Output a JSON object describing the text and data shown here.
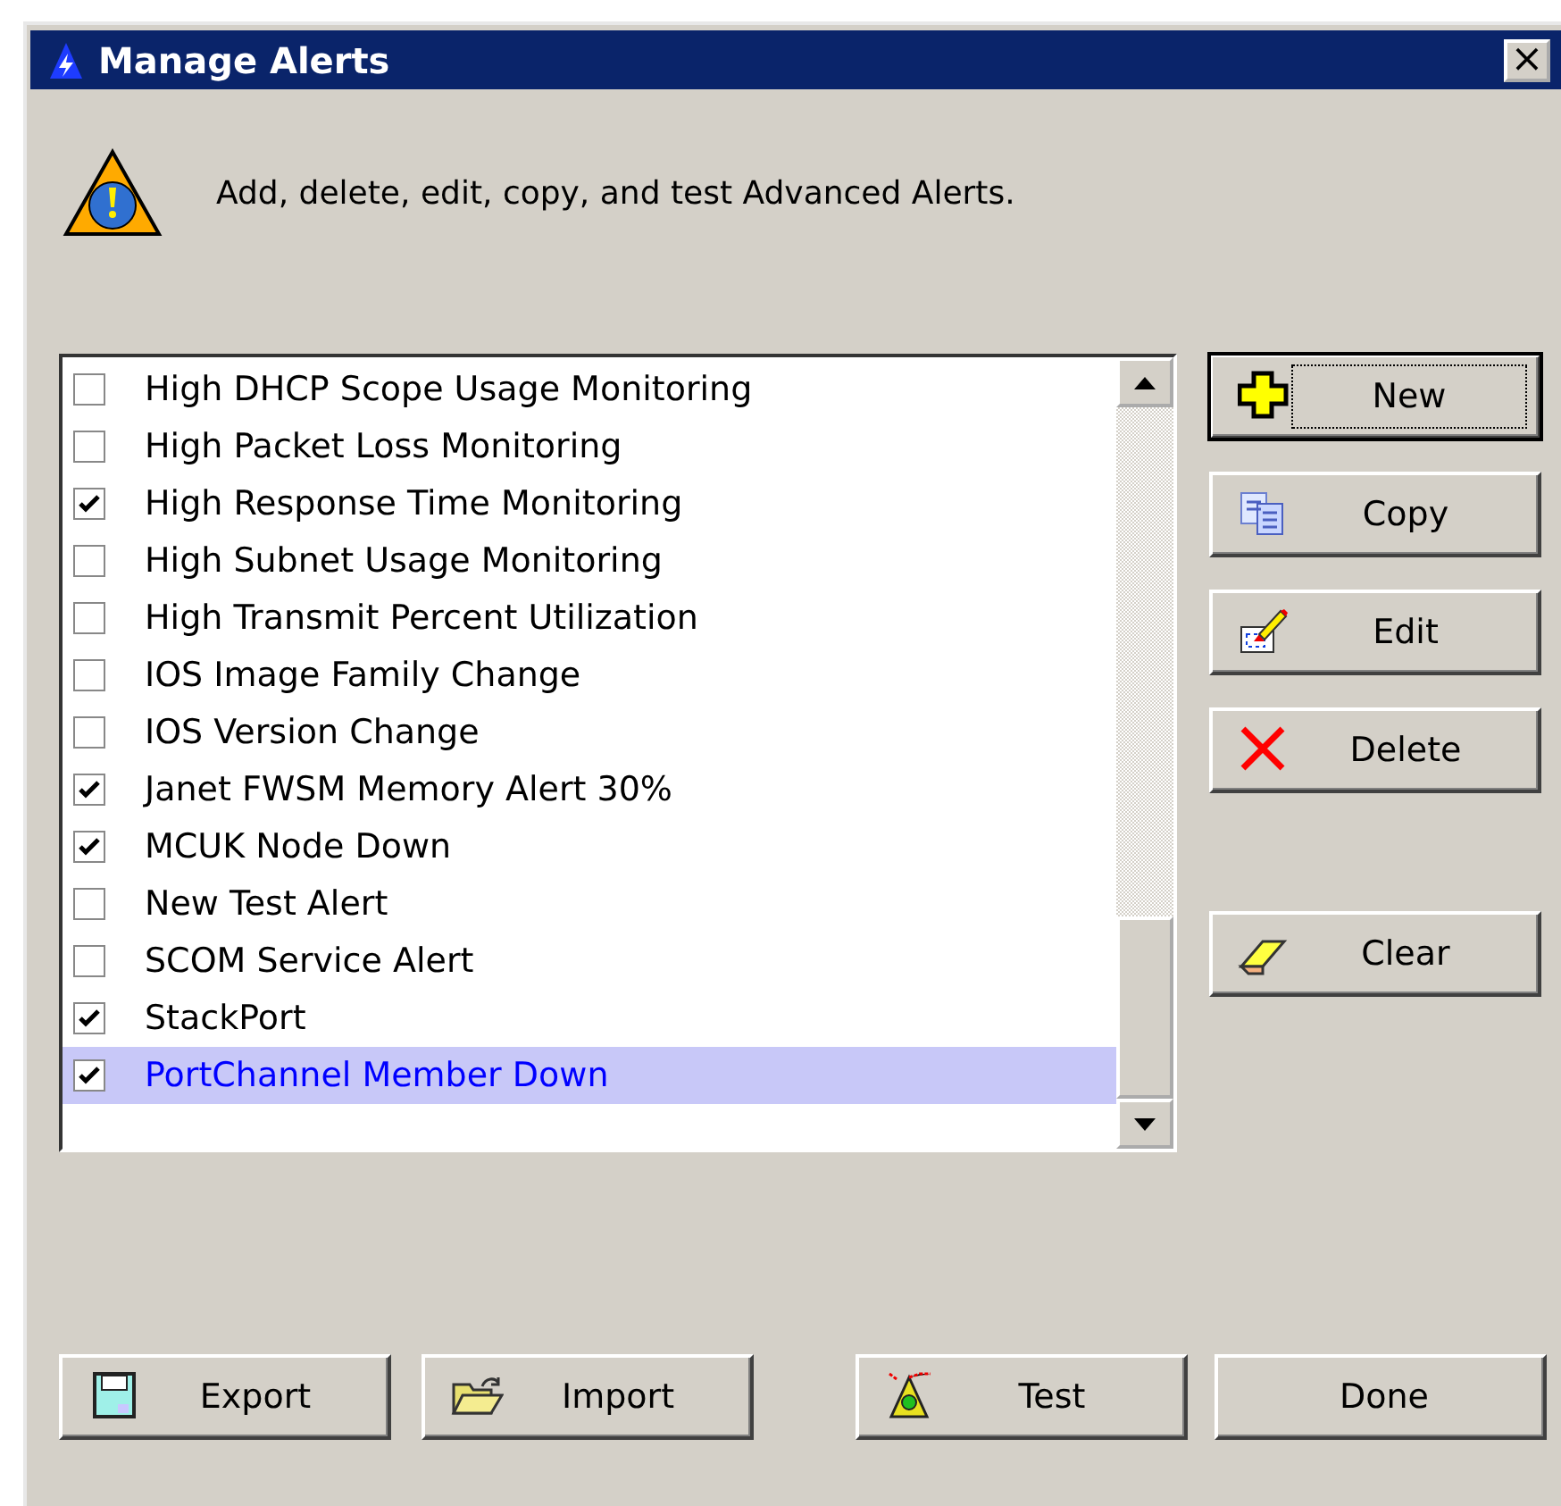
{
  "window": {
    "title": "Manage Alerts",
    "close": "×"
  },
  "header": {
    "text": "Add, delete, edit, copy, and test Advanced Alerts."
  },
  "alerts": [
    {
      "name": "High DHCP Scope Usage Monitoring",
      "checked": false,
      "selected": false
    },
    {
      "name": "High Packet Loss Monitoring",
      "checked": false,
      "selected": false
    },
    {
      "name": "High Response Time Monitoring",
      "checked": true,
      "selected": false
    },
    {
      "name": "High Subnet Usage Monitoring",
      "checked": false,
      "selected": false
    },
    {
      "name": "High Transmit Percent Utilization",
      "checked": false,
      "selected": false
    },
    {
      "name": "IOS Image Family Change",
      "checked": false,
      "selected": false
    },
    {
      "name": "IOS Version Change",
      "checked": false,
      "selected": false
    },
    {
      "name": "Janet FWSM Memory Alert 30%",
      "checked": true,
      "selected": false
    },
    {
      "name": "MCUK Node Down",
      "checked": true,
      "selected": false
    },
    {
      "name": "New Test Alert",
      "checked": false,
      "selected": false
    },
    {
      "name": "SCOM Service Alert",
      "checked": false,
      "selected": false
    },
    {
      "name": "StackPort",
      "checked": true,
      "selected": false
    },
    {
      "name": "PortChannel Member Down",
      "checked": true,
      "selected": true
    }
  ],
  "side_buttons": [
    {
      "label": "New",
      "kind": "new",
      "default": true
    },
    {
      "label": "Copy",
      "kind": "copy",
      "default": false
    },
    {
      "label": "Edit",
      "kind": "edit",
      "default": false
    },
    {
      "label": "Delete",
      "kind": "delete",
      "default": false
    },
    {
      "label": "Clear",
      "kind": "clear",
      "default": false
    }
  ],
  "bottom_buttons": [
    {
      "label": "Export",
      "kind": "export"
    },
    {
      "label": "Import",
      "kind": "import"
    },
    {
      "label": "Test",
      "kind": "test"
    },
    {
      "label": "Done",
      "kind": "plain"
    }
  ]
}
